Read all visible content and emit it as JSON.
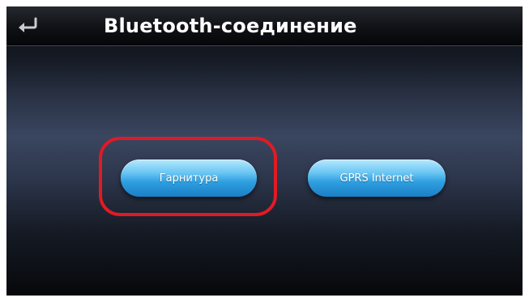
{
  "header": {
    "title": "Bluetooth-соединение",
    "back_icon": "return-arrow-icon"
  },
  "buttons": {
    "headset_label": "Гарнитура",
    "gprs_label": "GPRS Internet"
  },
  "colors": {
    "highlight": "#e01b24",
    "button_blue": "#2f9fe0",
    "title_text": "#ffffff"
  }
}
